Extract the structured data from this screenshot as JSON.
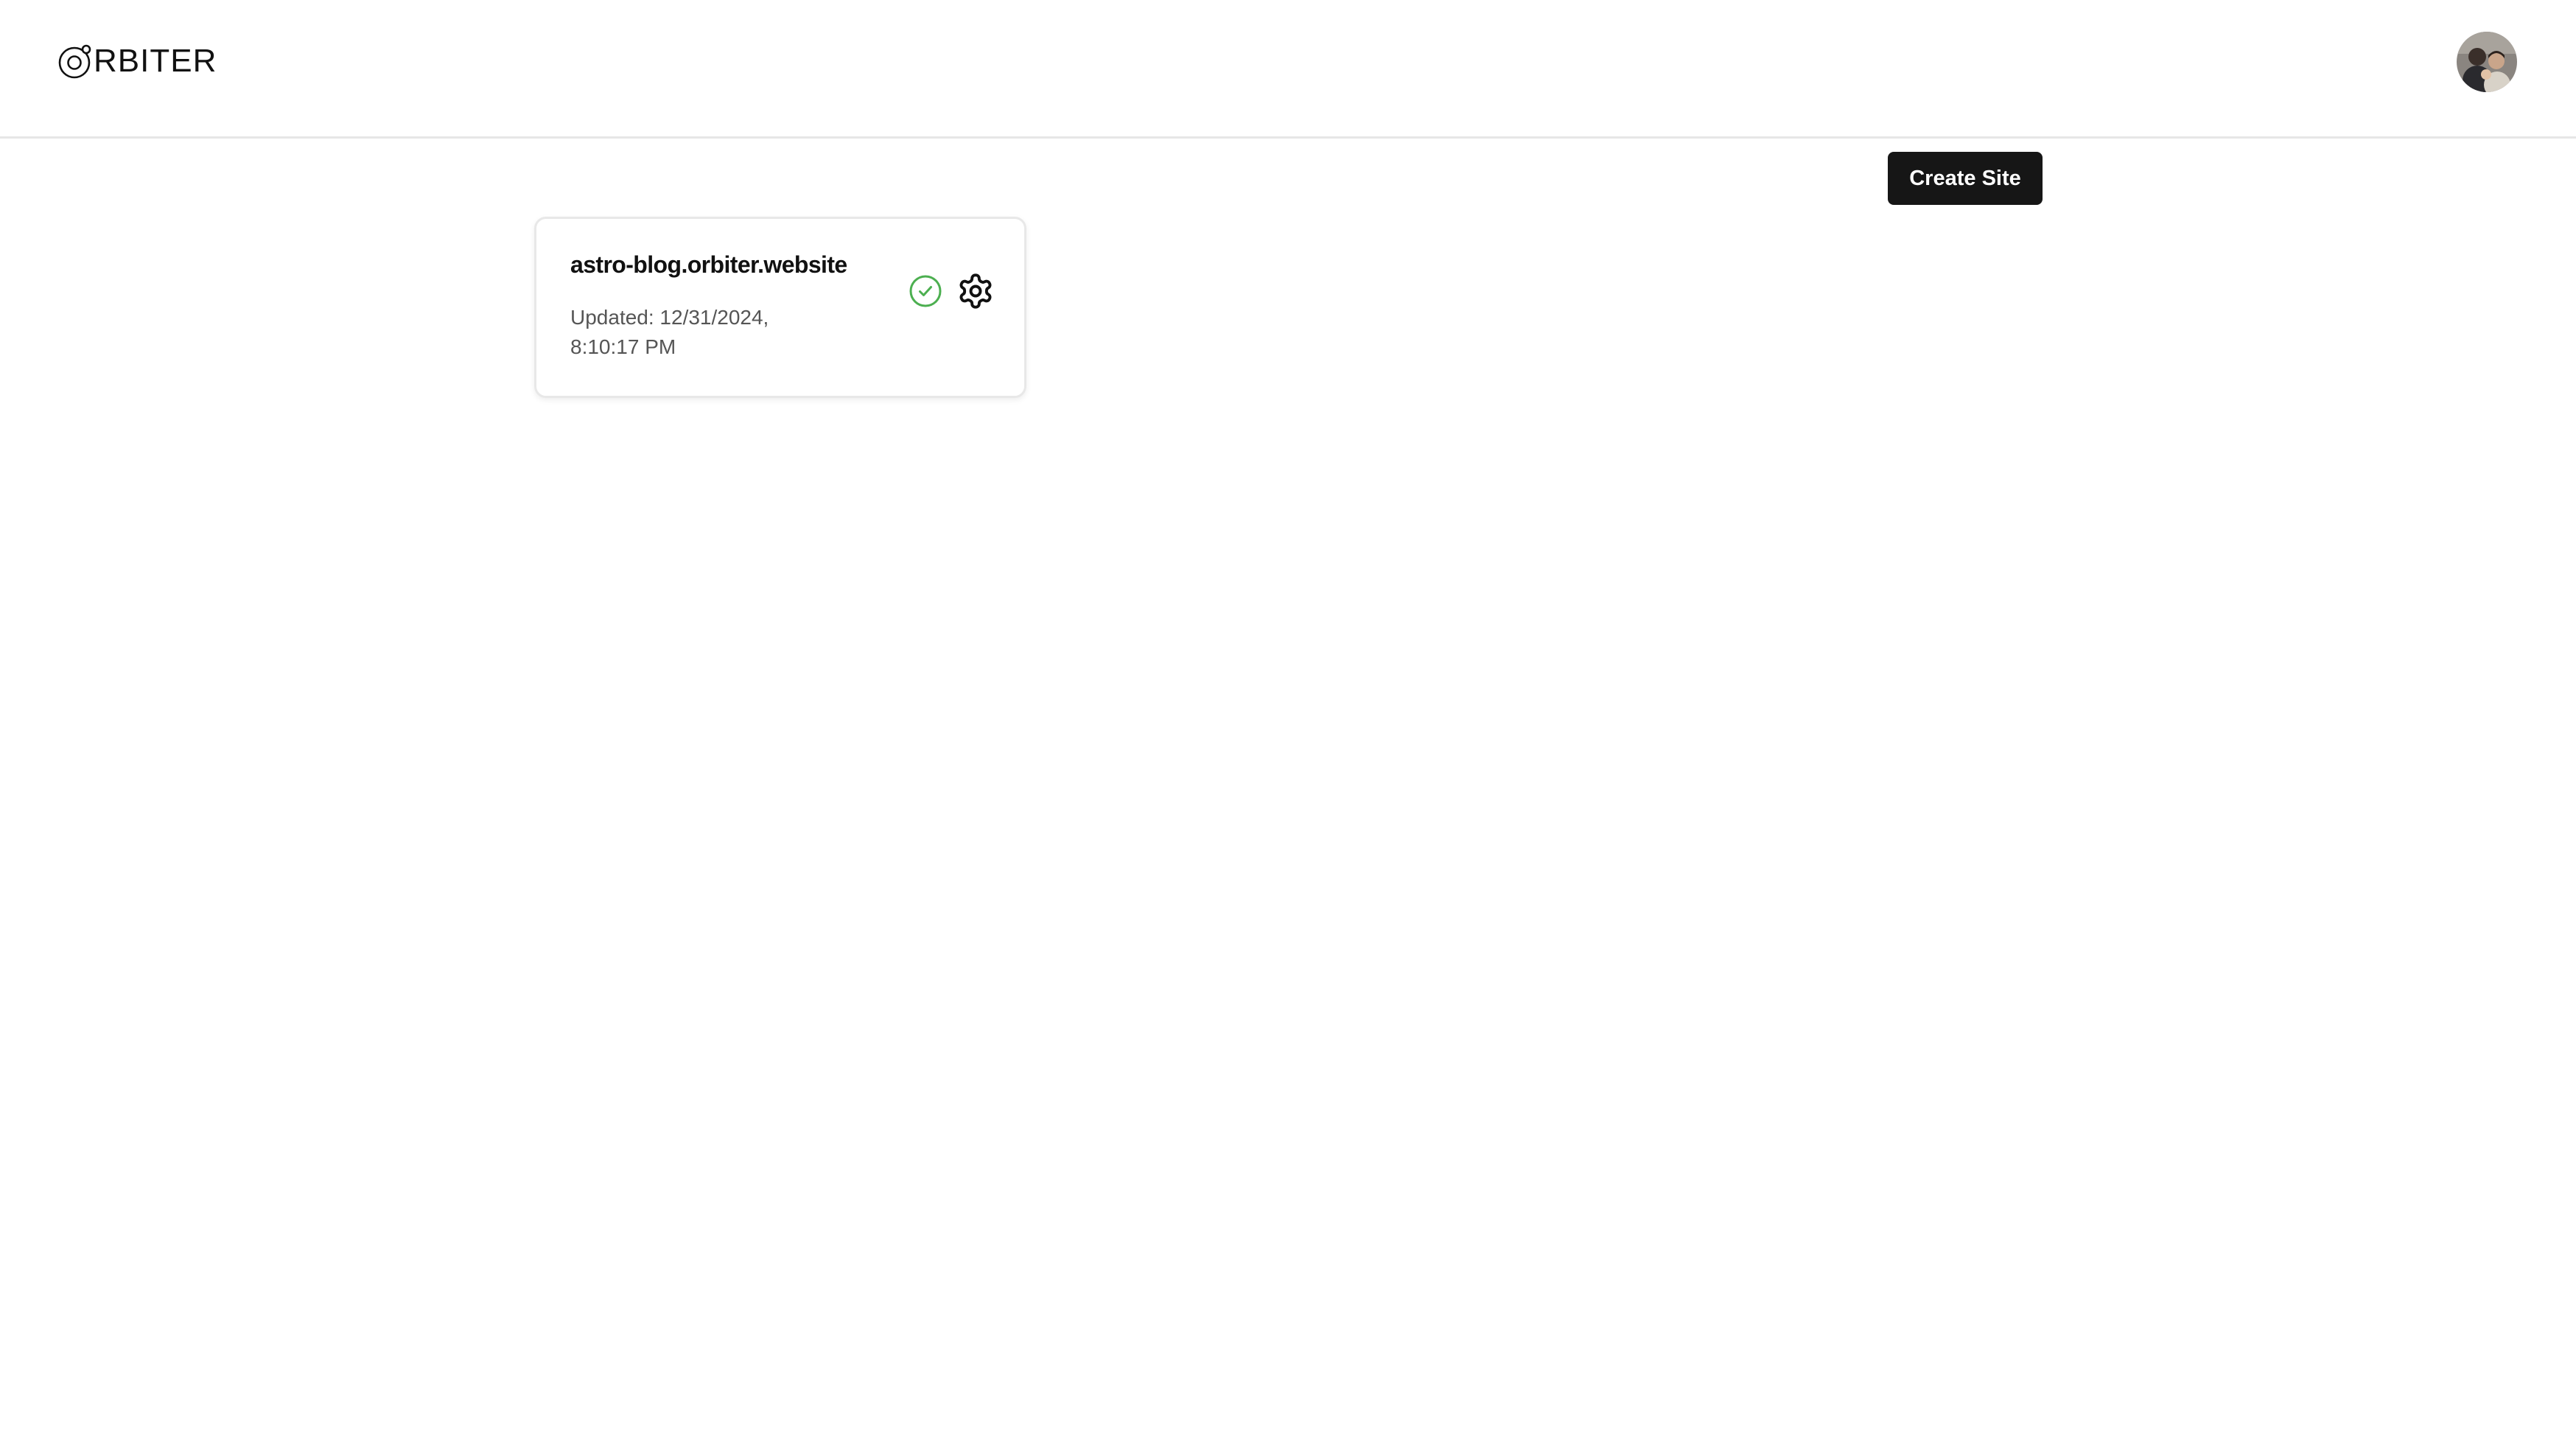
{
  "header": {
    "logo_text": "RBITER",
    "logo_mark_icon": "orbiter-o-icon",
    "avatar_icon": "user-avatar"
  },
  "toolbar": {
    "create_site_label": "Create Site",
    "accent": "#161616"
  },
  "sites": [
    {
      "name": "astro-blog.orbiter.website",
      "updated": "Updated: 12/31/2024, 8:10:17 PM",
      "status_icon": "check-circle-icon",
      "status_color": "#4caf50",
      "settings_icon": "gear-icon"
    }
  ]
}
